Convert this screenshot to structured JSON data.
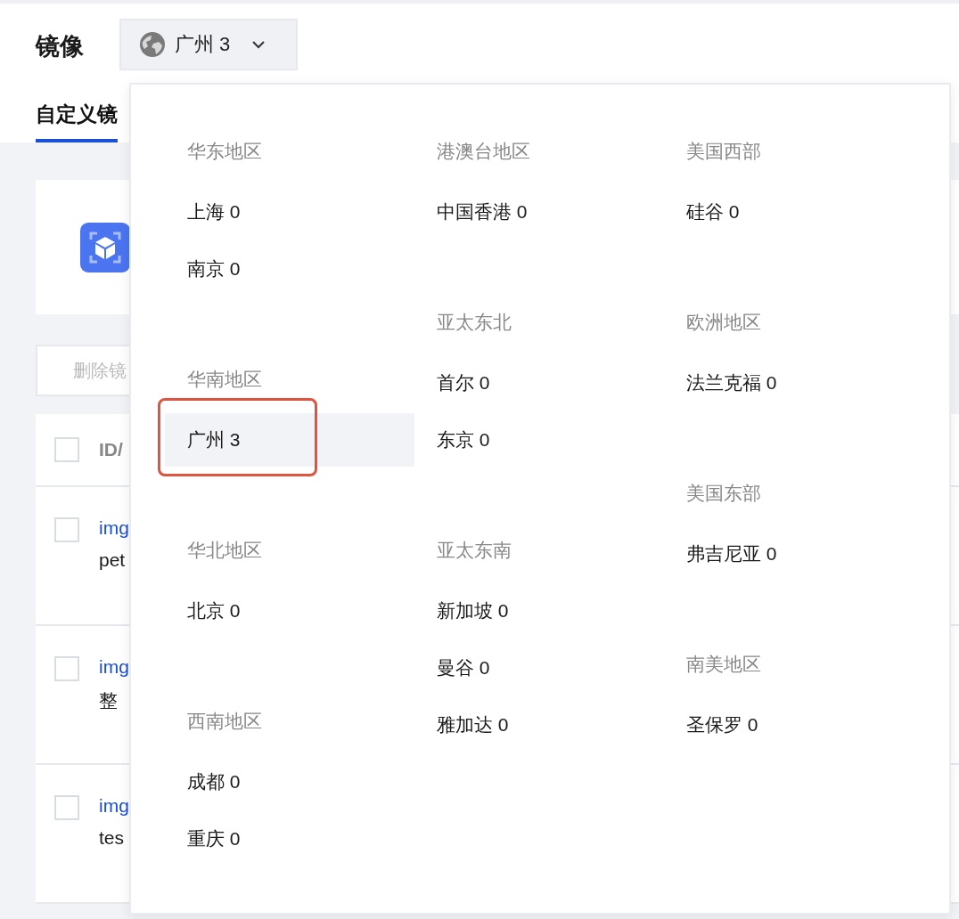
{
  "header": {
    "title": "镜像",
    "region_button": {
      "label": "广州 3",
      "expanded": true
    }
  },
  "tabs": [
    {
      "label": "自定义镜",
      "selected": true
    }
  ],
  "toolbar": {
    "delete_button": {
      "label": "删除镜",
      "disabled": true
    }
  },
  "table": {
    "select_all": {
      "checked": false
    },
    "columns": [
      {
        "label": "ID/"
      }
    ],
    "rows": [
      {
        "checked": false,
        "id": "img",
        "name": "pet"
      },
      {
        "checked": false,
        "id": "img",
        "name": "整"
      },
      {
        "checked": false,
        "id": "img",
        "name": "tes"
      }
    ]
  },
  "region_menu": {
    "columns": [
      [
        {
          "title": "华东地区",
          "items": [
            {
              "label": "上海 0",
              "selected": false,
              "outlined": false
            },
            {
              "label": "南京 0",
              "selected": false,
              "outlined": false
            }
          ]
        },
        {
          "title": "华南地区",
          "items": [
            {
              "label": "广州 3",
              "selected": true,
              "outlined": true
            }
          ]
        },
        {
          "title": "华北地区",
          "items": [
            {
              "label": "北京 0",
              "selected": false,
              "outlined": false
            }
          ]
        },
        {
          "title": "西南地区",
          "items": [
            {
              "label": "成都 0",
              "selected": false,
              "outlined": false
            },
            {
              "label": "重庆 0",
              "selected": false,
              "outlined": false
            }
          ]
        }
      ],
      [
        {
          "title": "港澳台地区",
          "items": [
            {
              "label": "中国香港 0",
              "selected": false,
              "outlined": false
            }
          ]
        },
        {
          "title": "亚太东北",
          "items": [
            {
              "label": "首尔 0",
              "selected": false,
              "outlined": false
            },
            {
              "label": "东京 0",
              "selected": false,
              "outlined": false
            }
          ]
        },
        {
          "title": "亚太东南",
          "items": [
            {
              "label": "新加坡 0",
              "selected": false,
              "outlined": false
            },
            {
              "label": "曼谷 0",
              "selected": false,
              "outlined": false
            },
            {
              "label": "雅加达 0",
              "selected": false,
              "outlined": false
            }
          ]
        }
      ],
      [
        {
          "title": "美国西部",
          "items": [
            {
              "label": "硅谷 0",
              "selected": false,
              "outlined": false
            }
          ]
        },
        {
          "title": "欧洲地区",
          "items": [
            {
              "label": "法兰克福 0",
              "selected": false,
              "outlined": false
            }
          ]
        },
        {
          "title": "美国东部",
          "items": [
            {
              "label": "弗吉尼亚 0",
              "selected": false,
              "outlined": false
            }
          ]
        },
        {
          "title": "南美地区",
          "items": [
            {
              "label": "圣保罗 0",
              "selected": false,
              "outlined": false
            }
          ]
        }
      ]
    ]
  }
}
